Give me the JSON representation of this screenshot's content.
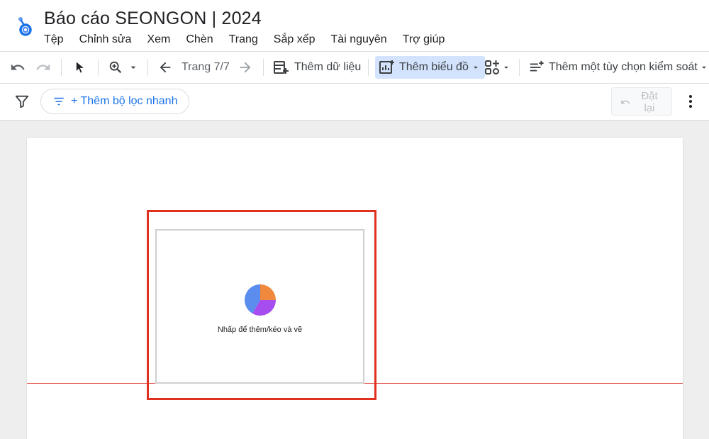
{
  "app": {
    "title": "Báo cáo SEONGON | 2024"
  },
  "menu": [
    "Tệp",
    "Chỉnh sửa",
    "Xem",
    "Chèn",
    "Trang",
    "Sắp xếp",
    "Tài nguyên",
    "Trợ giúp"
  ],
  "toolbar": {
    "page_indicator": "Trang 7/7",
    "add_data_label": "Thêm dữ liệu",
    "add_chart_label": "Thêm biểu đồ",
    "add_control_label": "Thêm một tùy chọn kiểm soát"
  },
  "filterbar": {
    "quick_filter_label": "+ Thêm bộ lọc nhanh",
    "reset_label_line1": "Đặt",
    "reset_label_line2": "lại"
  },
  "canvas": {
    "placeholder_text": "Nhấp để thêm/kéo và vẽ"
  },
  "icons": {
    "logo": "looker-studio-logo-icon",
    "undo": "undo-icon",
    "redo": "redo-icon",
    "select": "pointer-icon",
    "zoom": "zoom-in-icon",
    "prev": "arrow-back-icon",
    "next": "arrow-forward-icon",
    "add_data": "add-data-icon",
    "add_chart": "add-chart-icon",
    "components": "components-icon",
    "control": "add-control-icon",
    "filter": "filter-icon",
    "filter_lines": "filter-list-icon",
    "reset": "reset-undo-icon",
    "more": "more-vert-icon"
  },
  "colors": {
    "accent": "#1a73e8",
    "active_bg": "#d3e3fd",
    "highlight": "#e0301e",
    "pie_orange": "#f0883e",
    "pie_blue": "#5b8def",
    "pie_purple": "#a64df0"
  }
}
